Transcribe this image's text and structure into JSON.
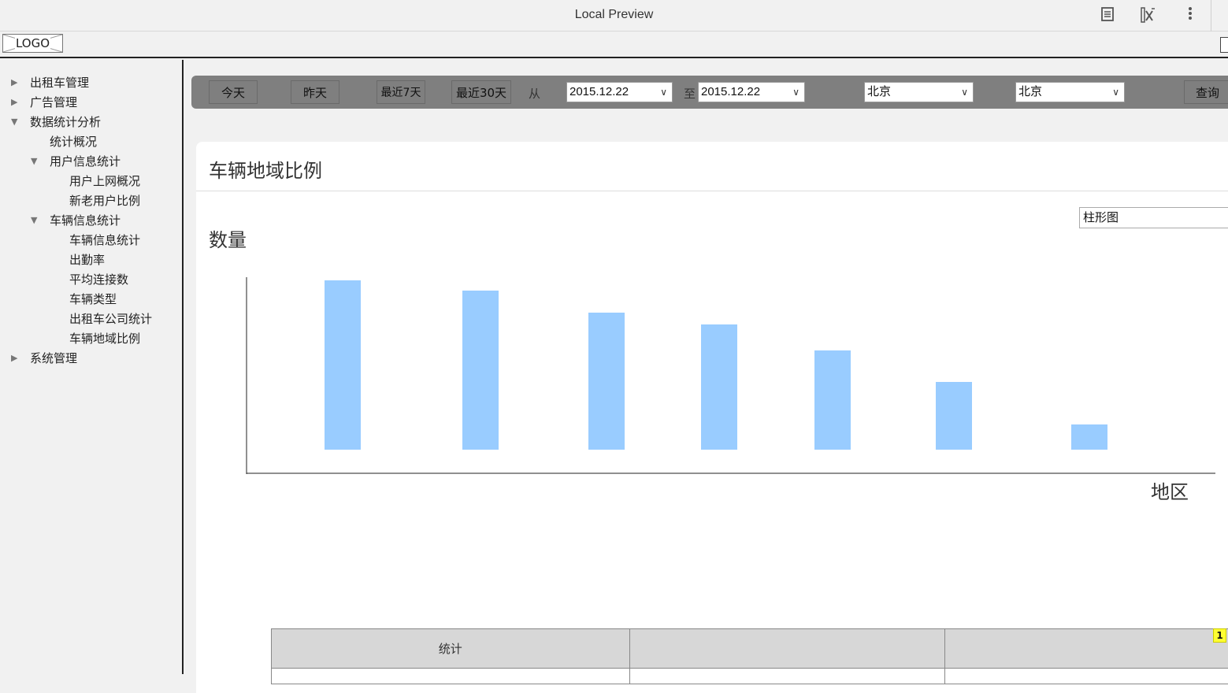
{
  "window": {
    "title": "Local Preview"
  },
  "logo": {
    "label": "LOGO"
  },
  "sidebar": {
    "items": [
      {
        "label": "出租车管理",
        "level": 0,
        "expanded": false
      },
      {
        "label": "广告管理",
        "level": 0,
        "expanded": false
      },
      {
        "label": "数据统计分析",
        "level": 0,
        "expanded": true
      },
      {
        "label": "统计概况",
        "level": 1,
        "leaf": true
      },
      {
        "label": "用户信息统计",
        "level": 1,
        "expanded": true
      },
      {
        "label": "用户上网概况",
        "level": 2,
        "leaf": true
      },
      {
        "label": "新老用户比例",
        "level": 2,
        "leaf": true
      },
      {
        "label": "车辆信息统计",
        "level": 1,
        "expanded": true
      },
      {
        "label": "车辆信息统计",
        "level": 2,
        "leaf": true
      },
      {
        "label": "出勤率",
        "level": 2,
        "leaf": true
      },
      {
        "label": "平均连接数",
        "level": 2,
        "leaf": true
      },
      {
        "label": "车辆类型",
        "level": 2,
        "leaf": true
      },
      {
        "label": "出租车公司统计",
        "level": 2,
        "leaf": true
      },
      {
        "label": "车辆地域比例",
        "level": 2,
        "leaf": true
      },
      {
        "label": "系统管理",
        "level": 0,
        "expanded": false
      }
    ]
  },
  "filters": {
    "today": "今天",
    "yesterday": "昨天",
    "last7": "最近7天",
    "last30": "最近30天",
    "from_label": "从",
    "from_date": "2015.12.22",
    "to_label": "至",
    "to_date": "2015.12.22",
    "region1": "北京",
    "region2": "北京",
    "query": "查询"
  },
  "panel": {
    "title": "车辆地域比例",
    "chart_type_value": "柱形图"
  },
  "chart_data": {
    "type": "bar",
    "ylabel": "数量",
    "xlabel": "地区",
    "values": [
      215,
      202,
      174,
      159,
      126,
      86,
      32
    ],
    "ylim": [
      0,
      250
    ],
    "bar_color": "#99ccff"
  },
  "table": {
    "headers": [
      "统计",
      "",
      ""
    ]
  },
  "badge": {
    "label": "1"
  }
}
